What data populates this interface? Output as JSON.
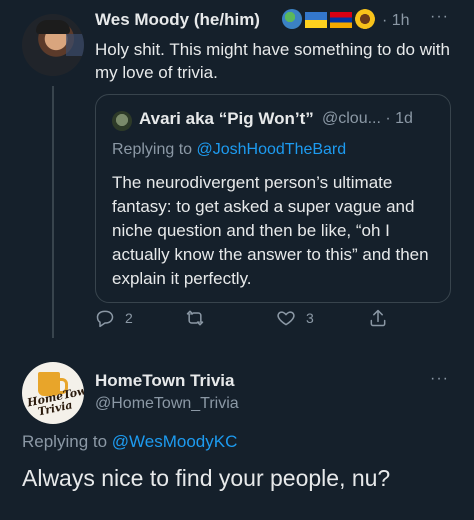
{
  "tweet1": {
    "name": "Wes Moody (he/him)",
    "badges": [
      "globe-emoji",
      "ukraine-flag-emoji",
      "armenia-flag-emoji",
      "sunflower-emoji"
    ],
    "time": "· 1h",
    "more": "···",
    "text": "Holy shit. This might have something to do with my love of trivia.",
    "quote": {
      "name": "Avari aka “Pig Won’t”",
      "handle_time": "@clou... · 1d",
      "replying_prefix": "Replying to ",
      "replying_to": "@JoshHoodTheBard",
      "text": "The neurodivergent person’s ultimate fantasy: to get asked a super vague and niche question and then be like, “oh I actually know the answer to this” and then explain it perfectly."
    },
    "actions": {
      "reply_count": "2",
      "retweet_count": "",
      "like_count": "3"
    }
  },
  "tweet2": {
    "name": "HomeTown Trivia",
    "handle": "@HomeTown_Trivia",
    "more": "···",
    "avatar_text": "HomeTown Trivia",
    "replying_prefix": "Replying to ",
    "replying_to": "@WesMoodyKC",
    "text": "Always nice to find your people, nu?"
  },
  "colors": {
    "background": "#15202b",
    "text": "#e7e9ea",
    "muted": "#8b98a5",
    "link": "#1d9bf0",
    "border": "#38444d"
  }
}
